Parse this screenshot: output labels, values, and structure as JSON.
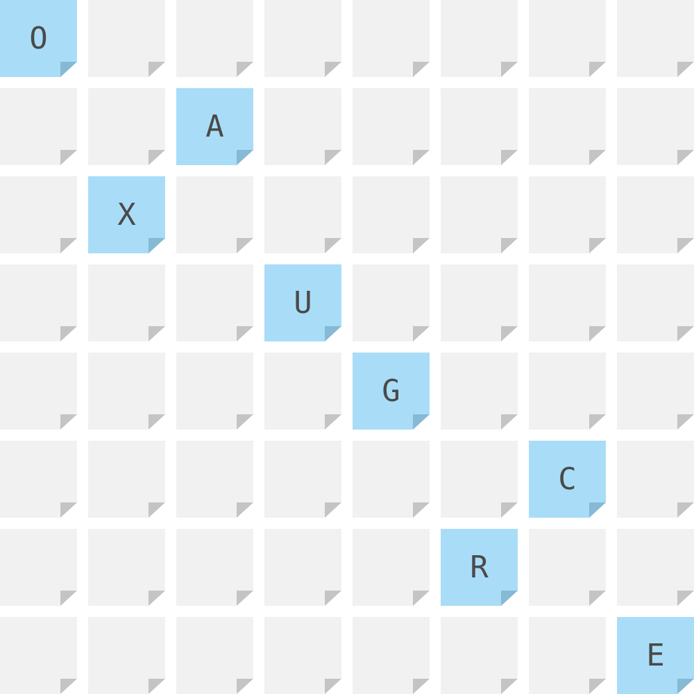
{
  "board": {
    "rows": 8,
    "cols": 8,
    "colors": {
      "tile": "#f1f1f1",
      "highlighted_tile": "#a9ddf7",
      "fold": "#c4c4c4",
      "highlighted_fold": "#86b9d3",
      "letter": "#4a4a4a",
      "background": "#ffffff"
    },
    "letters": [
      {
        "row": 0,
        "col": 0,
        "letter": "O"
      },
      {
        "row": 1,
        "col": 2,
        "letter": "A"
      },
      {
        "row": 2,
        "col": 1,
        "letter": "X"
      },
      {
        "row": 3,
        "col": 3,
        "letter": "U"
      },
      {
        "row": 4,
        "col": 4,
        "letter": "G"
      },
      {
        "row": 5,
        "col": 6,
        "letter": "C"
      },
      {
        "row": 6,
        "col": 5,
        "letter": "R"
      },
      {
        "row": 7,
        "col": 7,
        "letter": "E"
      }
    ]
  }
}
